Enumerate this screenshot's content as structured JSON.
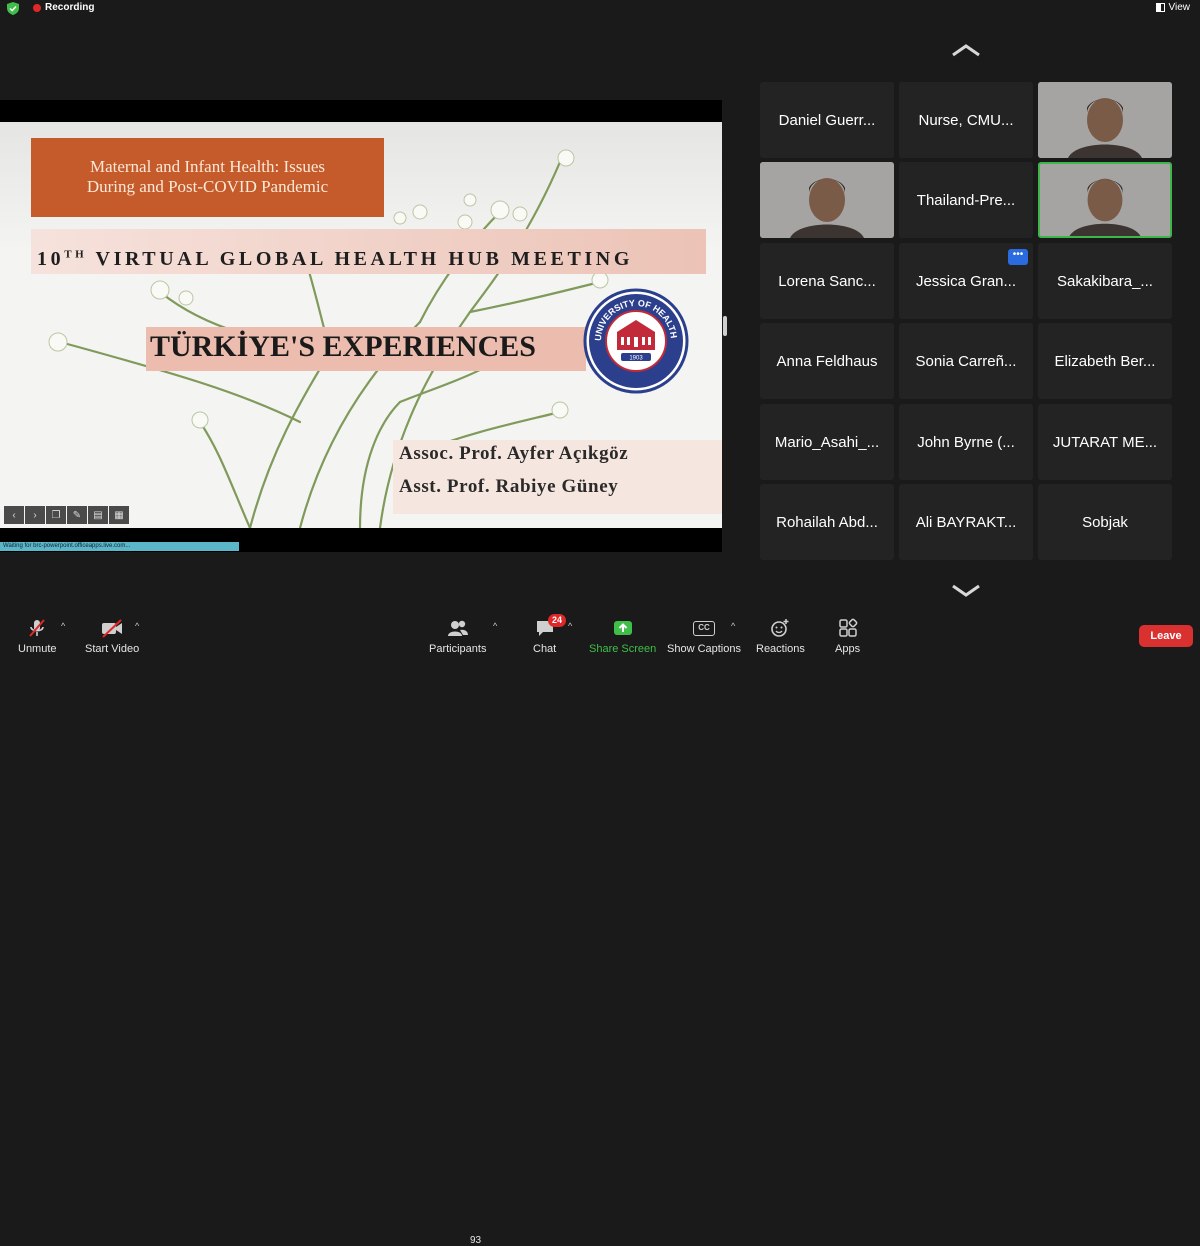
{
  "topbar": {
    "recording_label": "Recording",
    "view_label": "View"
  },
  "slide": {
    "title_line1": "Maternal and Infant Health: Issues",
    "title_line2": "During and Post-COVID Pandemic",
    "meeting_num": "10",
    "meeting_sup": "TH",
    "meeting_text": " VIRTUAL GLOBAL HEALTH HUB MEETING",
    "experiences": "TÜRKİYE'S EXPERIENCES",
    "seal_text": "UNIVERSITY OF HEALTH SCIENCES",
    "seal_year": "1903",
    "author1": "Assoc. Prof. Ayfer Açıkgöz",
    "author2": "Asst. Prof. Rabiye Güney",
    "status_text": "Waiting for brc-powerpoint.officeapps.live.com..."
  },
  "participants_grid": [
    {
      "name": "Daniel Guerr...",
      "video": false
    },
    {
      "name": "Nurse, CMU...",
      "video": false
    },
    {
      "name": "",
      "video": true
    },
    {
      "name": "",
      "video": true
    },
    {
      "name": "Thailand-Pre...",
      "video": false
    },
    {
      "name": "",
      "video": true,
      "active": true
    },
    {
      "name": "Lorena Sanc...",
      "video": false
    },
    {
      "name": "Jessica Gran...",
      "video": false,
      "more": true
    },
    {
      "name": "Sakakibara_...",
      "video": false
    },
    {
      "name": "Anna Feldhaus",
      "video": false
    },
    {
      "name": "Sonia Carreñ...",
      "video": false
    },
    {
      "name": "Elizabeth Ber...",
      "video": false
    },
    {
      "name": "Mario_Asahi_...",
      "video": false
    },
    {
      "name": "John Byrne (...",
      "video": false
    },
    {
      "name": "JUTARAT ME...",
      "video": false
    },
    {
      "name": "Rohailah Abd...",
      "video": false
    },
    {
      "name": "Ali BAYRAKT...",
      "video": false
    },
    {
      "name": "Sobjak",
      "video": false
    }
  ],
  "toolbar": {
    "unmute": "Unmute",
    "start_video": "Start Video",
    "participants": "Participants",
    "participants_count": "93",
    "chat": "Chat",
    "chat_badge": "24",
    "share_screen": "Share Screen",
    "show_captions": "Show Captions",
    "captions_icon": "CC",
    "reactions": "Reactions",
    "apps": "Apps",
    "leave": "Leave"
  },
  "colors": {
    "share_green": "#3fbf4a",
    "leave_red": "#d93030",
    "active_speaker": "#40b54a",
    "title_box": "#c55a2a"
  }
}
